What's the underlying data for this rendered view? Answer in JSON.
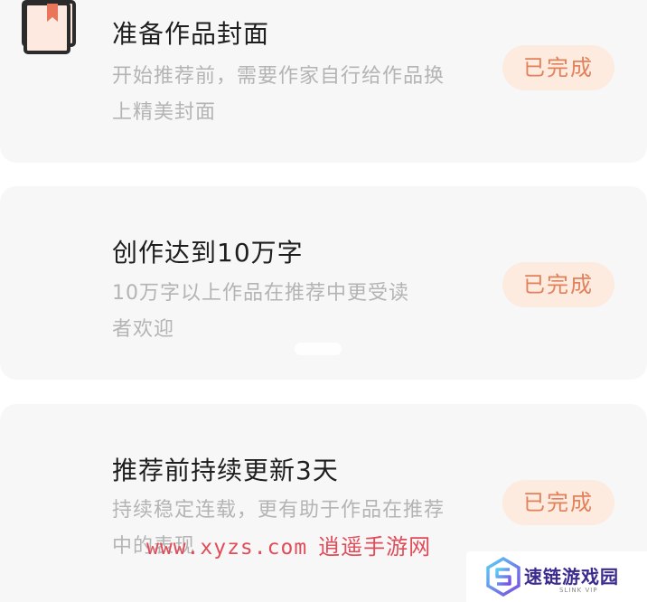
{
  "tasks": [
    {
      "icon": "image-icon",
      "title": "准备作品封面",
      "desc_line1": "开始推荐前，需要作家自行给作品换",
      "desc_line2": "上精美封面",
      "status": "已完成"
    },
    {
      "icon": "document-icon",
      "title": "创作达到10万字",
      "desc_line1": "10万字以上作品在推荐中更受读",
      "desc_line2": "者欢迎",
      "status": "已完成"
    },
    {
      "icon": "bookmark-book-icon",
      "title": "推荐前持续更新3天",
      "desc_line1": "持续稳定连载，更有助于作品在推荐",
      "desc_line2": "中的表现",
      "status": "已完成"
    }
  ],
  "watermark": {
    "url": "www.xyzs.com",
    "brand": "逍遥手游网"
  },
  "logo": {
    "title": "速链游戏园",
    "subtitle": "SLINK VIP"
  },
  "colors": {
    "accent": "#e2815a",
    "status_bg": "#fcebde",
    "card_bg": "#f7f7f7",
    "watermark": "#e14c59"
  }
}
